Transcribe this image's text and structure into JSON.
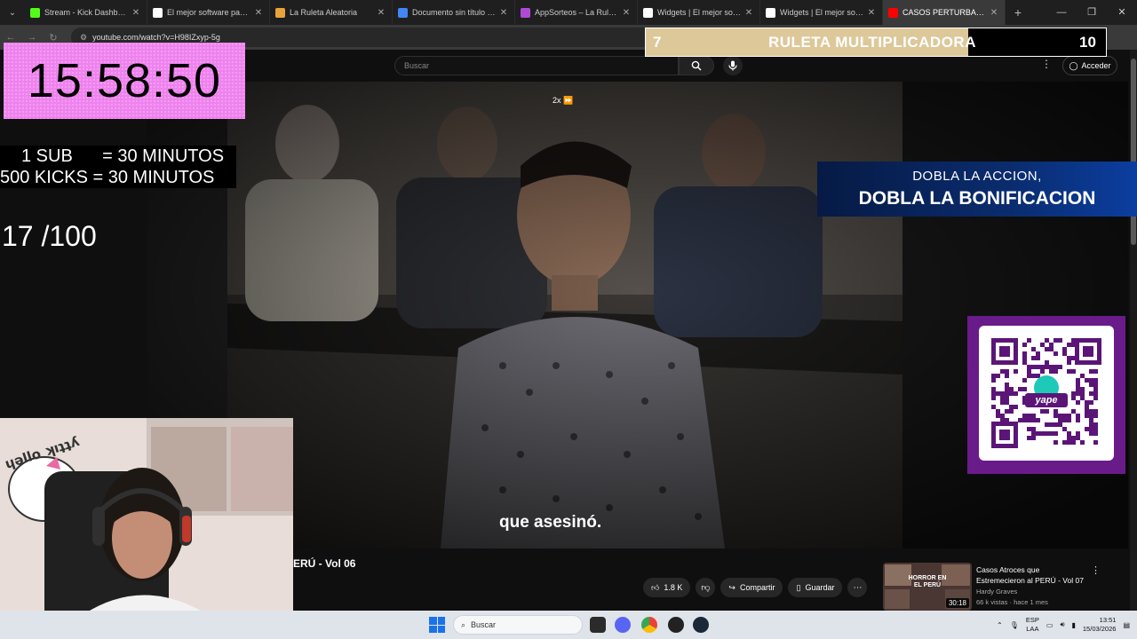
{
  "browser": {
    "tabs": [
      {
        "title": "Stream - Kick Dashboard",
        "favicon_color": "#53fc18",
        "active": false
      },
      {
        "title": "El mejor software para pc",
        "favicon_color": "#ffffff",
        "active": false
      },
      {
        "title": "La Ruleta Aleatoria",
        "favicon_color": "#e8a33d",
        "active": false
      },
      {
        "title": "Documento sin título - Do",
        "favicon_color": "#4285f4",
        "active": false
      },
      {
        "title": "AppSorteos – La Ruleta de",
        "favicon_color": "#b04ad6",
        "active": false
      },
      {
        "title": "Widgets | El mejor softwa",
        "favicon_color": "#ffffff",
        "active": false
      },
      {
        "title": "Widgets | El mejor softwa",
        "favicon_color": "#ffffff",
        "active": false
      },
      {
        "title": "CASOS PERTURBADO",
        "favicon_color": "#ff0000",
        "active": true
      }
    ],
    "url": "youtube.com/watch?v=H98IZxyp-5g"
  },
  "youtube": {
    "search_placeholder": "Buscar",
    "login_label": "Acceder",
    "speed_label": "2x",
    "subtitle": "que asesinó.",
    "video_title": "ERÚ - Vol 06",
    "likes": "1.8 K",
    "share_label": "Compartir",
    "save_label": "Guardar",
    "recommendation": {
      "title": "Casos Atroces que Estremecieron al PERÚ - Vol 07",
      "channel": "Hardy Graves",
      "meta": "66 k vistas · hace 1 mes",
      "duration": "30:18",
      "thumb_text": "HORROR EN EL PERÚ"
    }
  },
  "overlay": {
    "timer": "15:58:50",
    "timer_bg": "#ee82ee",
    "rule_sub": "1 SUB      = 30 MINUTOS",
    "rule_kicks": "500 KICKS = 30 MINUTOS",
    "counter": "17 /100",
    "ruleta": {
      "left_value": "7",
      "title": "RULETA MULTIPLICADORA",
      "right_value": "10",
      "progress": 0.7,
      "fill_color": "#ddc89a"
    },
    "promo_line1": "DOBLA LA ACCION,",
    "promo_line2": "DOBLA LA BONIFICACION",
    "qr_brand": "yape"
  },
  "taskbar": {
    "search_label": "Buscar",
    "lang_top": "ESP",
    "lang_bottom": "LAA",
    "time": "13:51",
    "date": "15/03/2026"
  }
}
